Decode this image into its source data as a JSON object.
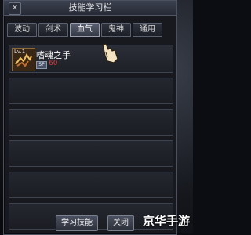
{
  "window": {
    "title": "技能学习栏",
    "close_glyph": "✕"
  },
  "tabs": [
    {
      "label": "波动",
      "active": false
    },
    {
      "label": "剑术",
      "active": false
    },
    {
      "label": "血气",
      "active": true
    },
    {
      "label": "鬼神",
      "active": false
    },
    {
      "label": "通用",
      "active": false
    }
  ],
  "skills": [
    {
      "level_tag": "Lv.1",
      "name": "嗜魂之手",
      "sp_label": "SP",
      "sp_cost": "60"
    }
  ],
  "buttons": {
    "learn": "学习技能",
    "close": "关闭"
  },
  "watermark": "京华手游",
  "colors": {
    "sp_cost": "#d83a3a",
    "active_tab": "#5a6070"
  }
}
